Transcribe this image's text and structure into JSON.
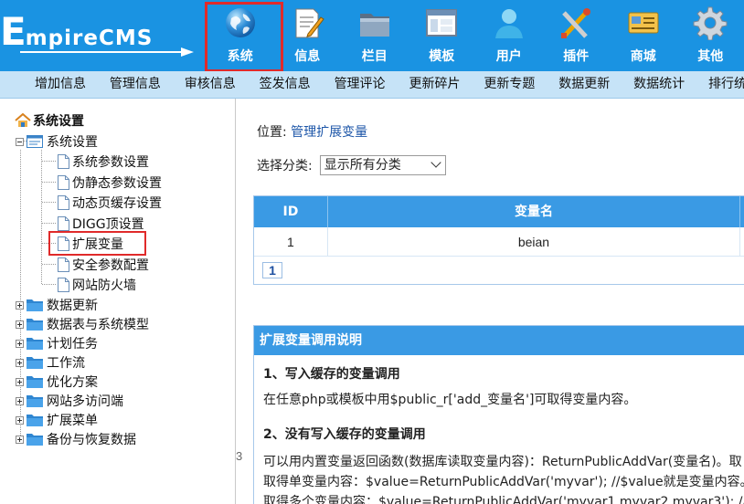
{
  "logo": {
    "first_letter": "E",
    "rest": "mpireCMS"
  },
  "nav": [
    {
      "label": "系统",
      "icon": "globe-icon",
      "active": true
    },
    {
      "label": "信息",
      "icon": "document-edit-icon"
    },
    {
      "label": "栏目",
      "icon": "folder-icon"
    },
    {
      "label": "模板",
      "icon": "window-template-icon"
    },
    {
      "label": "用户",
      "icon": "user-icon"
    },
    {
      "label": "插件",
      "icon": "tools-icon"
    },
    {
      "label": "商城",
      "icon": "card-icon"
    },
    {
      "label": "其他",
      "icon": "gear-icon"
    }
  ],
  "submenu": [
    "增加信息",
    "管理信息",
    "审核信息",
    "签发信息",
    "管理评论",
    "更新碎片",
    "更新专题",
    "数据更新",
    "数据统计",
    "排行统"
  ],
  "sidebar": {
    "root": "系统设置",
    "group": "系统设置",
    "items": [
      "系统参数设置",
      "伪静态参数设置",
      "动态页缓存设置",
      "DIGG顶设置",
      "扩展变量",
      "安全参数配置",
      "网站防火墙"
    ],
    "selected": "扩展变量",
    "folders": [
      "数据更新",
      "数据表与系统模型",
      "计划任务",
      "工作流",
      "优化方案",
      "网站多访问端",
      "扩展菜单",
      "备份与恢复数据"
    ],
    "splitter_label": "3"
  },
  "main": {
    "location_prefix": "位置: ",
    "location_link": "管理扩展变量",
    "category_label": "选择分类:",
    "category_value": "显示所有分类",
    "table": {
      "headers": [
        "ID",
        "变量名"
      ],
      "rows": [
        {
          "id": "1",
          "name": "beian"
        }
      ],
      "page": "1"
    },
    "help": {
      "title": "扩展变量调用说明",
      "h1": "1、写入缓存的变量调用",
      "p1": "在任意php或模板中用$public_r['add_变量名']可取得变量内容。",
      "h2": "2、没有写入缓存的变量调用",
      "p2": "可以用内置变量返回函数(数据库读取变量内容)：ReturnPublicAddVar(变量名)。取",
      "p3": "取得单变量内容：$value=ReturnPublicAddVar('myvar'); //$value就是变量内容。",
      "p4": "取得多个变量内容：$value=ReturnPublicAddVar('myvar1,myvar2,myvar3'); //$v"
    }
  },
  "colors": {
    "header": "#1a93e2",
    "submenu": "#c6e3f7",
    "table_head": "#3a9ae4",
    "highlight": "#e02a2a"
  }
}
